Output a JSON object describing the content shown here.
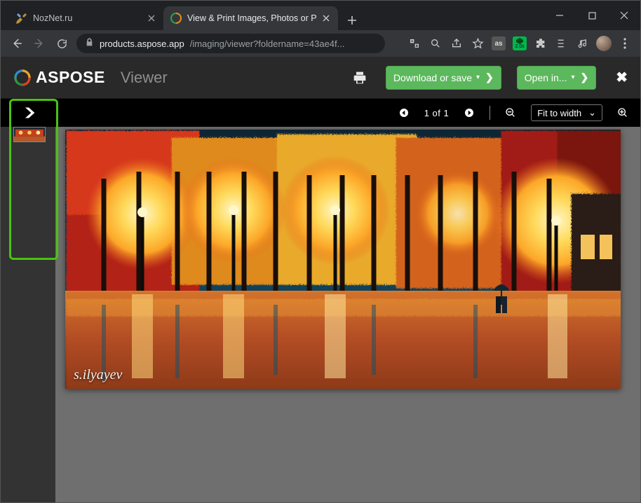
{
  "browser": {
    "tabs": [
      {
        "title": "NozNet.ru",
        "active": false
      },
      {
        "title": "View & Print Images, Photos or P",
        "active": true
      }
    ],
    "url_host": "products.aspose.app",
    "url_path": "/imaging/viewer?foldername=43ae4f...",
    "adblock_badge": "2.0s"
  },
  "header": {
    "brand": "ASPOSE",
    "app": "Viewer",
    "download_label": "Download or save",
    "open_label": "Open in..."
  },
  "viewer": {
    "page_indicator": "1 of 1",
    "fit_label": "Fit to width"
  },
  "image": {
    "signature": "s.ilyayev"
  }
}
